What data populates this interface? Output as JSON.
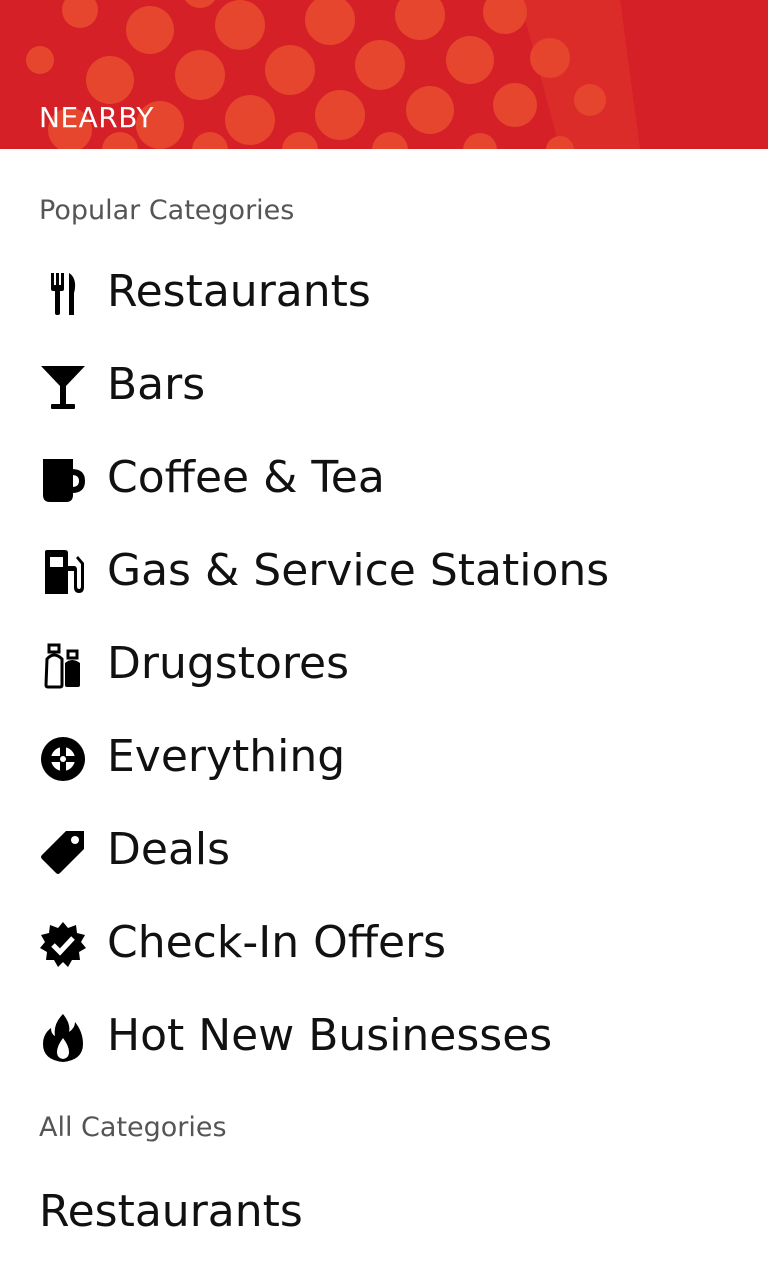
{
  "header": {
    "title": "NEARBY",
    "background_color": "#d62028",
    "dot_color": "#e5462d"
  },
  "popular": {
    "label": "Popular Categories",
    "items": [
      {
        "label": "Restaurants",
        "icon": "fork-knife-icon"
      },
      {
        "label": "Bars",
        "icon": "martini-glass-icon"
      },
      {
        "label": "Coffee & Tea",
        "icon": "coffee-mug-icon"
      },
      {
        "label": "Gas & Service Stations",
        "icon": "gas-pump-icon"
      },
      {
        "label": "Drugstores",
        "icon": "medicine-bottles-icon"
      },
      {
        "label": "Everything",
        "icon": "crosshair-circle-icon"
      },
      {
        "label": "Deals",
        "icon": "price-tag-icon"
      },
      {
        "label": "Check-In Offers",
        "icon": "verified-badge-icon"
      },
      {
        "label": "Hot New Businesses",
        "icon": "flame-icon"
      }
    ]
  },
  "all": {
    "label": "All Categories",
    "items": [
      {
        "label": "Restaurants"
      }
    ]
  }
}
